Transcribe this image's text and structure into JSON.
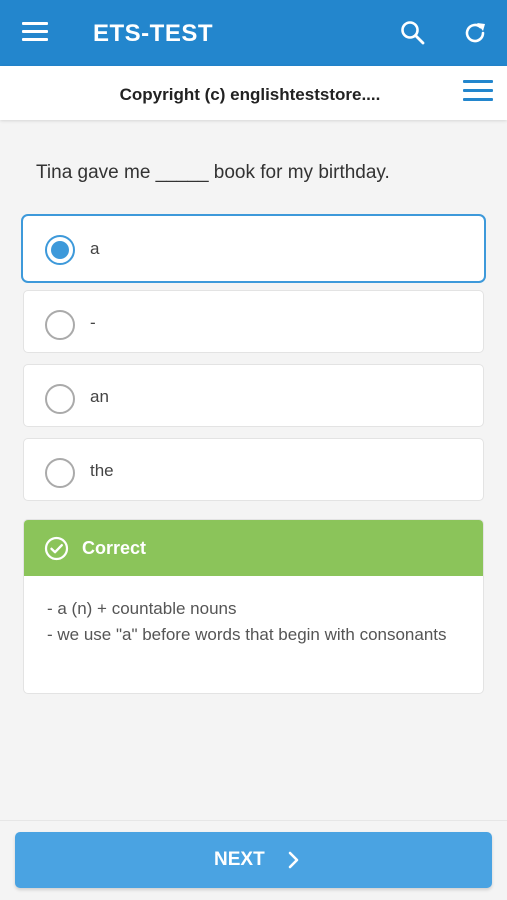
{
  "appbar": {
    "title": "ETS-TEST",
    "menu_icon": "hamburger-icon",
    "search_icon": "search-icon",
    "refresh_icon": "refresh-icon",
    "color": "#2386cd"
  },
  "subbar": {
    "copyright": "Copyright (c) englishteststore....",
    "list_icon": "list-icon"
  },
  "question": {
    "text": "Tina gave me _____ book for my birthday."
  },
  "options": [
    {
      "label": "a",
      "selected": true
    },
    {
      "label": "-",
      "selected": false
    },
    {
      "label": "an",
      "selected": false
    },
    {
      "label": "the",
      "selected": false
    }
  ],
  "result": {
    "status": "Correct",
    "status_color": "#8bc45a",
    "explanation_lines": [
      "- a (n) + countable nouns",
      "- we use \"a\" before words that begin with consonants"
    ]
  },
  "footer": {
    "next_label": "NEXT",
    "next_color": "#4aa3e2"
  }
}
